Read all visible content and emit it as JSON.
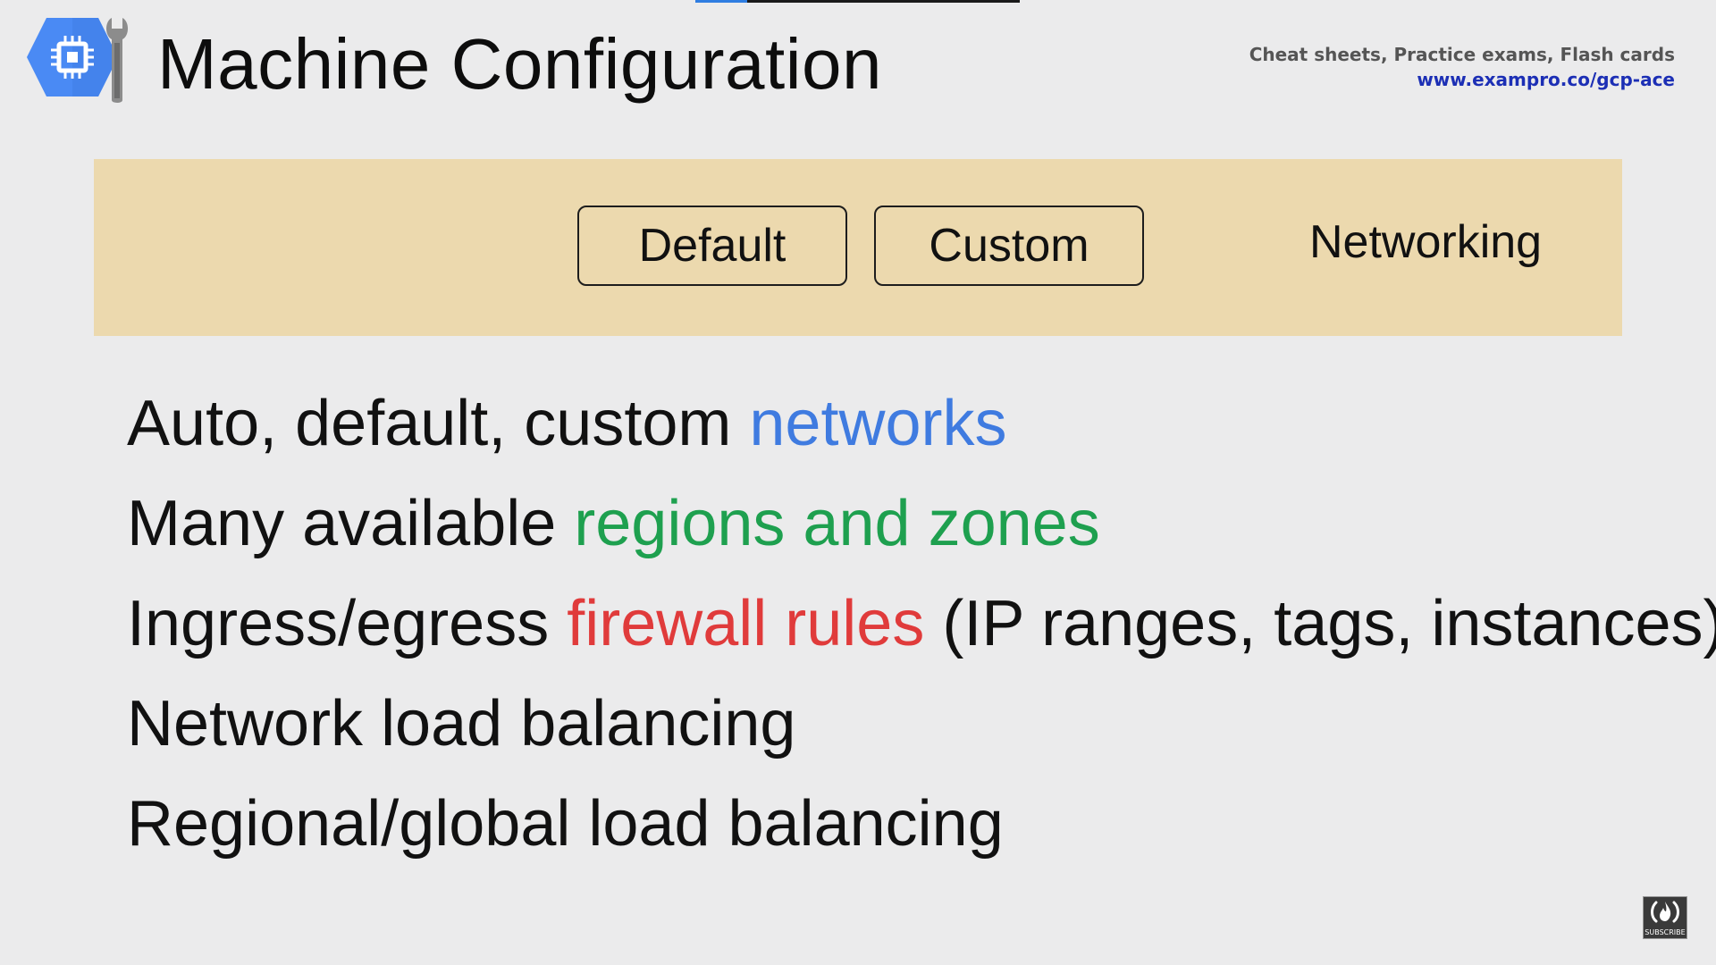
{
  "video": {
    "progress_fraction": 0.16,
    "progress_color": "#2f7de1"
  },
  "header": {
    "logo_icon": "gcp-compute-engine-icon",
    "title": "Machine Configuration",
    "promo_tagline": "Cheat sheets, Practice exams, Flash cards",
    "promo_url": "www.exampro.co/gcp-ace"
  },
  "tabs": {
    "default_label": "Default",
    "custom_label": "Custom",
    "section_label": "Networking"
  },
  "bullets": [
    {
      "text": "Auto, default, custom ",
      "highlight": "networks",
      "highlight_color": "#3f7be0",
      "suffix": ""
    },
    {
      "text": "Many available ",
      "highlight": "regions and zones",
      "highlight_color": "#1ea04f",
      "suffix": ""
    },
    {
      "text": "Ingress/egress ",
      "highlight": "firewall rules",
      "highlight_color": "#e03b3b",
      "suffix": " (IP ranges, tags, instances)"
    },
    {
      "text": "Network load balancing",
      "highlight": "",
      "highlight_color": "",
      "suffix": ""
    },
    {
      "text": "Regional/global load balancing",
      "highlight": "",
      "highlight_color": "",
      "suffix": ""
    }
  ],
  "overlay": {
    "subscribe_icon": "freecodecamp-flame-icon",
    "subscribe_label": "SUBSCRIBE"
  },
  "colors": {
    "background": "#ebebec",
    "tab_band": "#ecd9ae",
    "logo_blue": "#4a8af4",
    "promo_link": "#1c2fb5"
  }
}
